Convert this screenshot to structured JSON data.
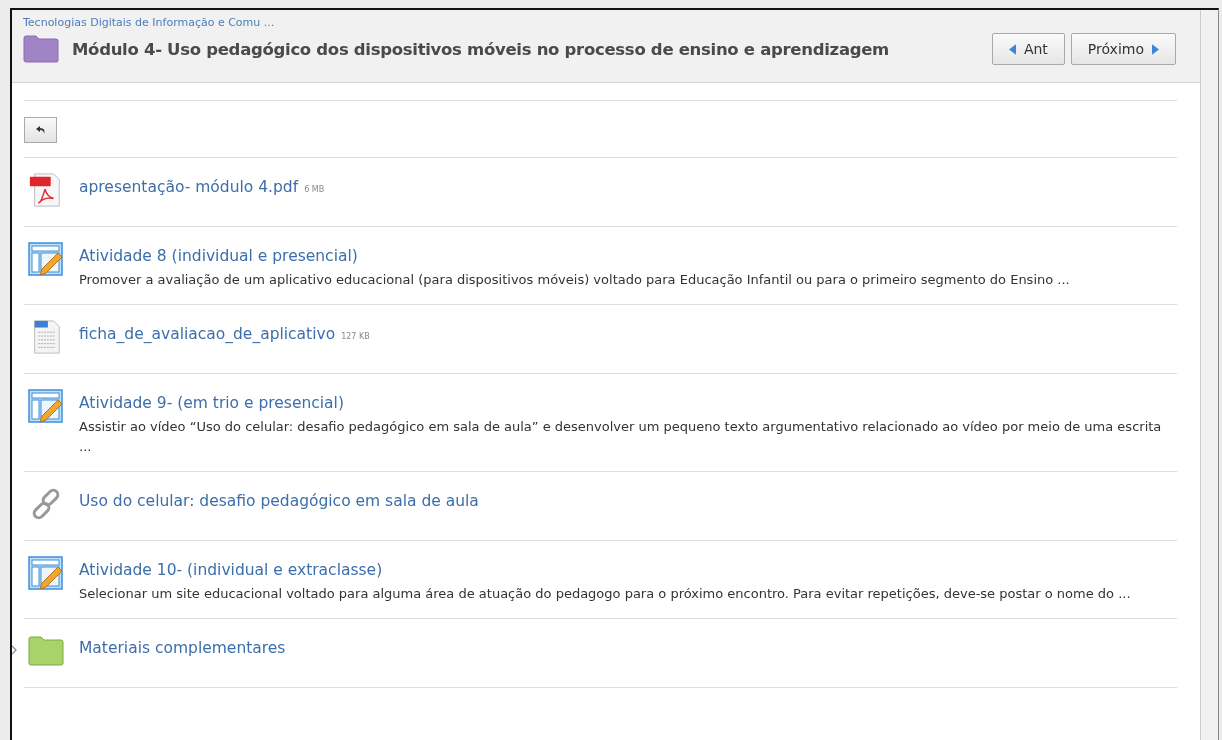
{
  "breadcrumb": "Tecnologias Digitais de Informação e Comu ...",
  "title": "Módulo 4- Uso pedagógico dos dispositivos móveis no processo de ensino e aprendizagem",
  "nav_buttons": [
    {
      "label": "Ant",
      "kind": "prev"
    },
    {
      "label": "Próximo",
      "kind": "next"
    }
  ],
  "items": [
    {
      "kind": "pdf",
      "title": "apresentação- módulo 4.pdf",
      "size": "6 MB"
    },
    {
      "kind": "assignment",
      "title": "Atividade 8 (individual e presencial)",
      "description": "Promover a avaliação de um aplicativo educacional (para dispositivos móveis) voltado para Educação Infantil ou para o primeiro segmento do Ensino ..."
    },
    {
      "kind": "doc",
      "title": "ficha_de_avaliacao_de_aplicativo",
      "size": "127 KB"
    },
    {
      "kind": "assignment",
      "title": "Atividade 9- (em trio e presencial)",
      "description": "Assistir ao vídeo “Uso do celular: desafio pedagógico em sala de aula” e desenvolver um pequeno texto argumentativo relacionado ao vídeo por meio de uma escrita ..."
    },
    {
      "kind": "url",
      "title": "Uso do celular: desafio pedagógico em sala de aula"
    },
    {
      "kind": "assignment",
      "title": "Atividade 10- (individual e extraclasse)",
      "description": "Selecionar um site educacional voltado para alguma área de atuação do pedagogo para o próximo encontro. Para evitar repetições, deve-se postar o nome do ..."
    },
    {
      "kind": "folder",
      "title": "Materiais complementares",
      "expanded": false
    }
  ]
}
